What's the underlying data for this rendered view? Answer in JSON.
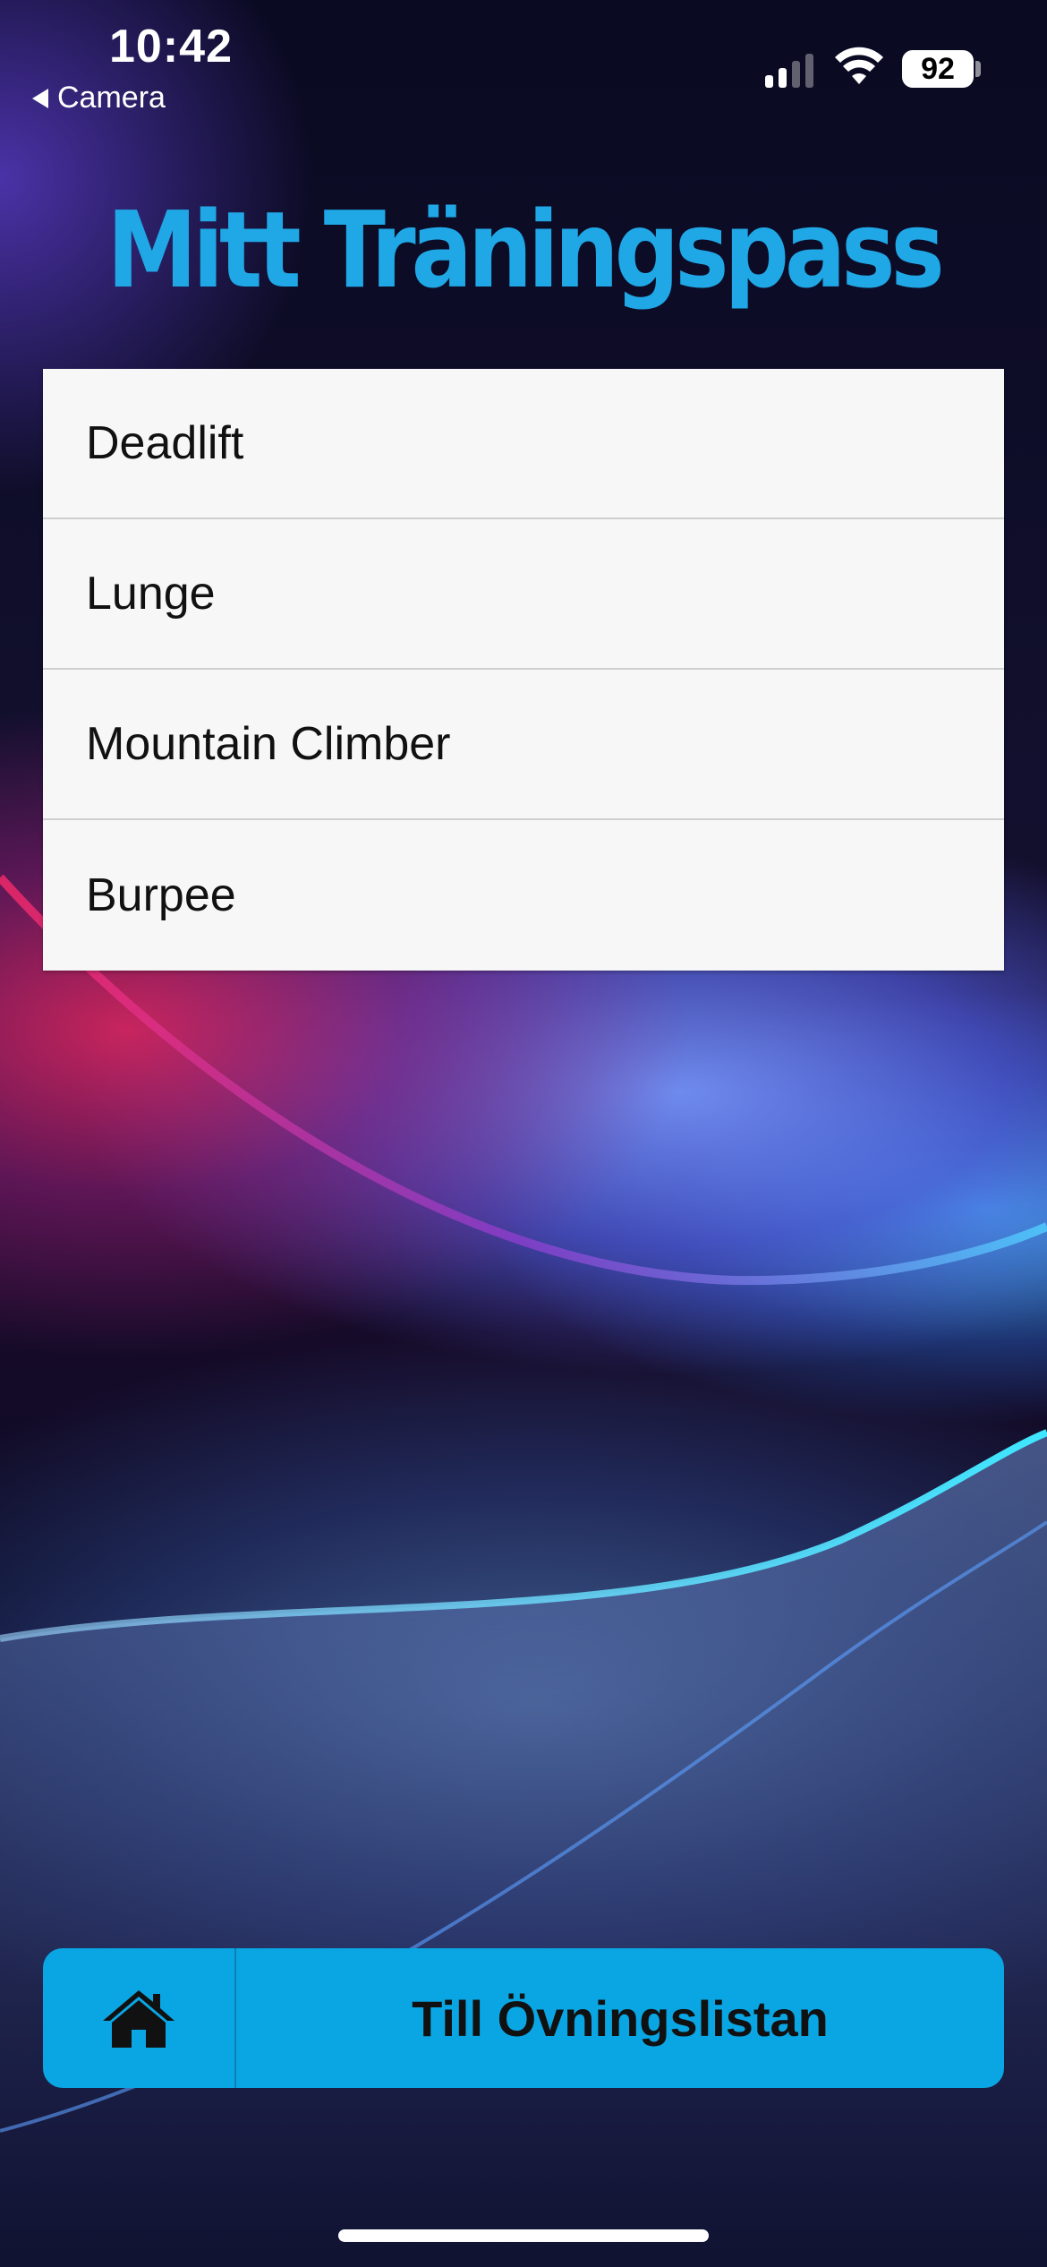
{
  "status_bar": {
    "time": "10:42",
    "back_label": "Camera",
    "battery": "92"
  },
  "title": "Mitt Träningspass",
  "exercises": [
    {
      "label": "Deadlift"
    },
    {
      "label": "Lunge"
    },
    {
      "label": "Mountain Climber"
    },
    {
      "label": "Burpee"
    }
  ],
  "bottom_bar": {
    "home_icon": "home-icon",
    "list_button_label": "Till Övningslistan"
  },
  "colors": {
    "accent": "#1fa7e6",
    "button_bg": "#0aa6e4",
    "list_bg": "#f7f7f7"
  }
}
